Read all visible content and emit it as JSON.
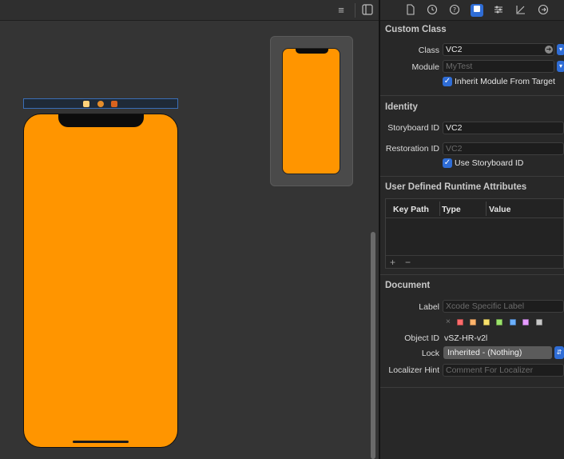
{
  "canvas": {
    "topbar": {
      "list_icon": "list-icon",
      "inspector_toggle_icon": "inspector-toggle-icon"
    },
    "scene_bar_icons": [
      "view-controller-icon",
      "first-responder-icon",
      "exit-icon"
    ],
    "scene_bar_colors": [
      "#ffd27a",
      "#e58d2a",
      "#d9631e"
    ],
    "view_background": "#ff9500"
  },
  "inspector": {
    "tabs": [
      "file-icon",
      "history-icon",
      "help-icon",
      "identity-icon",
      "attributes-icon",
      "size-icon",
      "connections-icon"
    ],
    "active_tab": "identity-icon",
    "custom_class": {
      "title": "Custom Class",
      "class_label": "Class",
      "class_value": "VC2",
      "module_label": "Module",
      "module_placeholder": "MyTest",
      "inherit_label": "Inherit Module From Target",
      "inherit_checked": true
    },
    "identity": {
      "title": "Identity",
      "storyboard_id_label": "Storyboard ID",
      "storyboard_id_value": "VC2",
      "restoration_id_label": "Restoration ID",
      "restoration_id_placeholder": "VC2",
      "use_storyboard_label": "Use Storyboard ID",
      "use_storyboard_checked": true
    },
    "runtime_attributes": {
      "title": "User Defined Runtime Attributes",
      "columns": [
        "Key Path",
        "Type",
        "Value"
      ],
      "add": "+",
      "remove": "−"
    },
    "document": {
      "title": "Document",
      "label_label": "Label",
      "label_placeholder": "Xcode Specific Label",
      "clear_glyph": "×",
      "label_colors": [
        "#ff6b6b",
        "#ffb36b",
        "#f7e06b",
        "#9be36b",
        "#6bb0ff",
        "#e59bff",
        "#c8c8c8"
      ],
      "object_id_label": "Object ID",
      "object_id_value": "vSZ-HR-v2l",
      "lock_label": "Lock",
      "lock_value": "Inherited - (Nothing)",
      "localizer_label": "Localizer Hint",
      "localizer_placeholder": "Comment For Localizer"
    }
  }
}
